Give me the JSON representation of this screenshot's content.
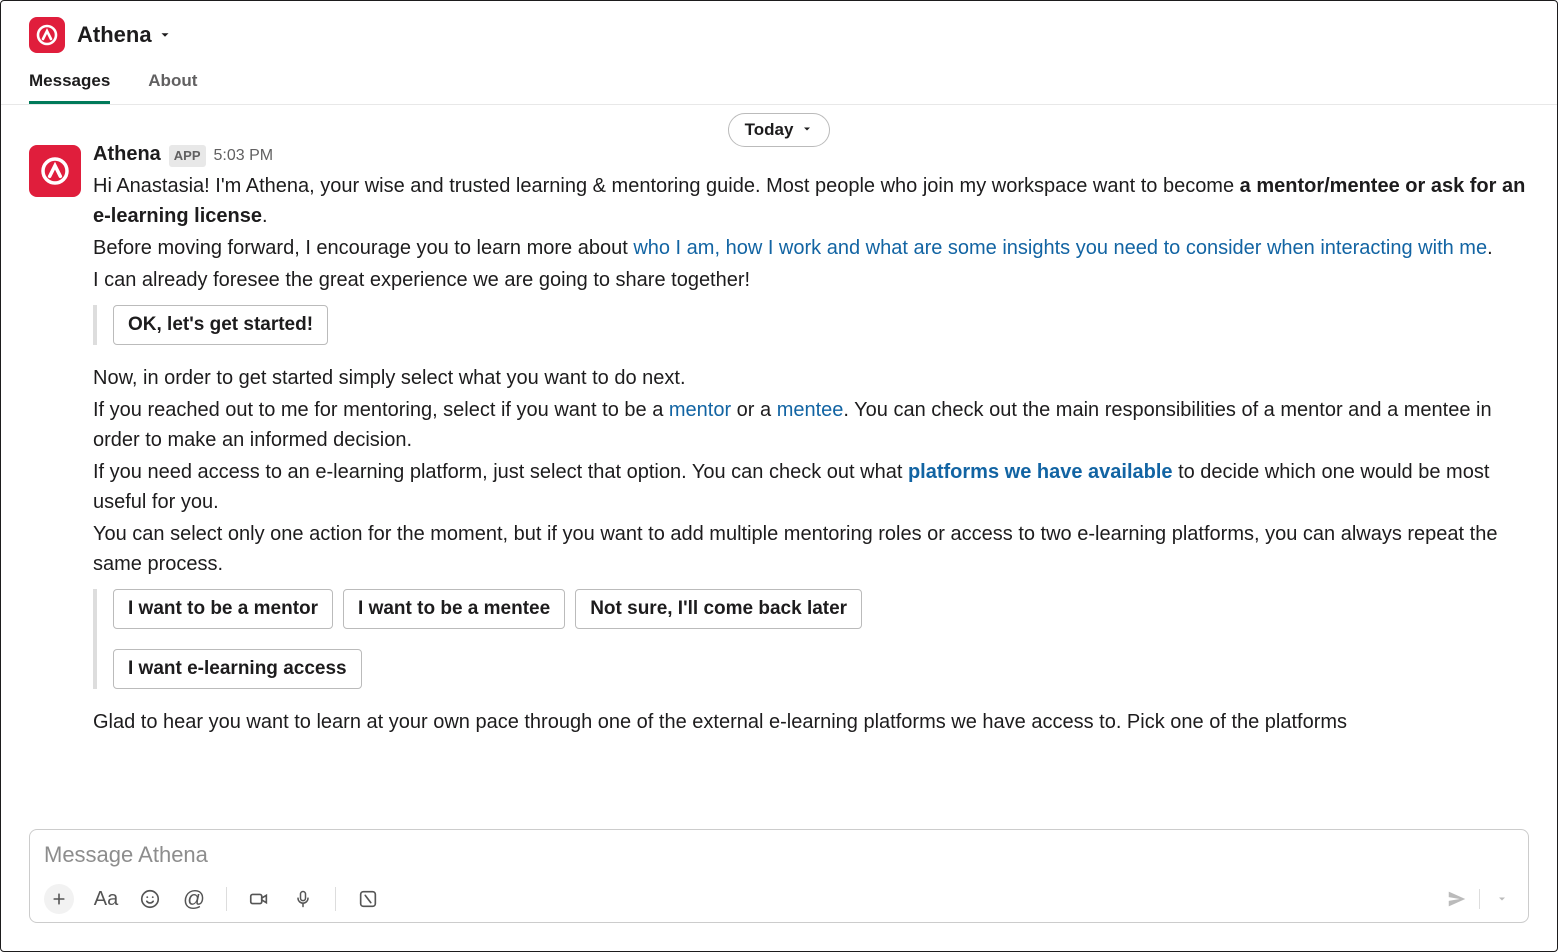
{
  "header": {
    "app_name": "Athena",
    "tabs": {
      "messages": "Messages",
      "about": "About"
    }
  },
  "date_divider": "Today",
  "message": {
    "sender": "Athena",
    "app_badge": "APP",
    "timestamp": "5:03 PM",
    "p1_a": "Hi Anastasia! I'm Athena, your wise and trusted learning & mentoring guide. Most people who join my workspace want to become ",
    "p1_bold": "a mentor/mentee or ask for an e-learning license",
    "p1_c": ".",
    "p2_a": "Before moving forward, I encourage you to learn more about ",
    "p2_link": "who I am, how I work and what are some insights you need to consider when interacting with me",
    "p2_c": ".",
    "p3": "I can already foresee the great experience we are going to share together!",
    "btn_start": "OK, let's get started!",
    "p4": "Now, in order to get started simply select what you want to do next.",
    "p5_a": "If you reached out to me for mentoring, select if you want to be a ",
    "p5_link1": "mentor",
    "p5_b": " or a ",
    "p5_link2": "mentee",
    "p5_c": ". You can check out the main responsibilities of a mentor and a mentee in order to make an informed decision.",
    "p6_a": "If you need access to an e-learning platform, just select that option. You can check out what ",
    "p6_link": "platforms we have available",
    "p6_b": " to decide which one would be most useful for you.",
    "p7": "You can select only one action for the moment, but if you want to add multiple mentoring roles or access to two e-learning platforms, you can always repeat the same process.",
    "btn_mentor": "I want to be a mentor",
    "btn_mentee": "I want to be a mentee",
    "btn_notsure": "Not sure, I'll come back later",
    "btn_elearn": "I want e-learning access",
    "p8": "Glad to hear you want to learn at your own pace through one of the external e-learning platforms we have access to. Pick one of the platforms"
  },
  "composer": {
    "placeholder": "Message Athena"
  }
}
